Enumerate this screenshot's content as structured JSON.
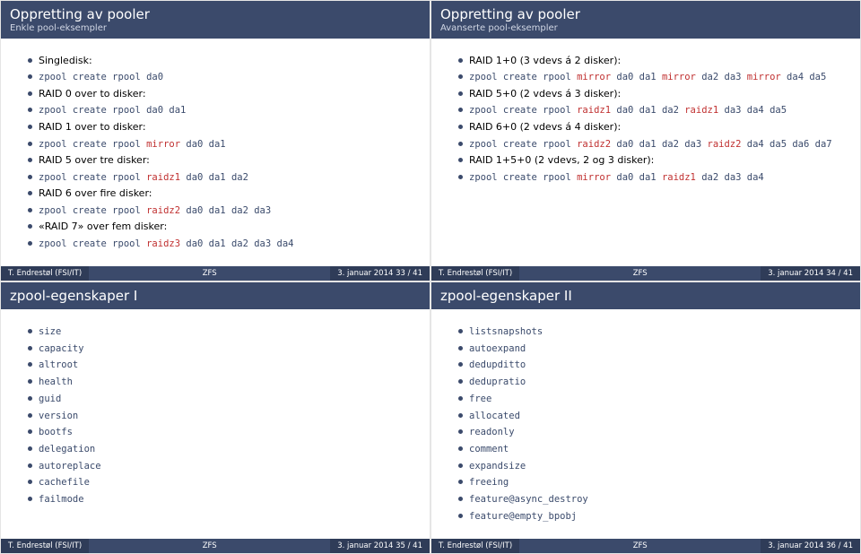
{
  "slides": [
    {
      "title": "Oppretting av pooler",
      "subtitle": "Enkle pool-eksempler",
      "items": [
        [
          {
            "t": "Singledisk:"
          }
        ],
        [
          {
            "t": "zpool create rpool da0",
            "mono": true
          }
        ],
        [
          {
            "t": "RAID 0 over to disker:"
          }
        ],
        [
          {
            "t": "zpool create rpool da0 da1",
            "mono": true
          }
        ],
        [
          {
            "t": "RAID 1 over to disker:"
          }
        ],
        [
          {
            "t": "zpool create rpool ",
            "mono": true
          },
          {
            "t": "mirror",
            "mono": true,
            "kw": true
          },
          {
            "t": " da0 da1",
            "mono": true
          }
        ],
        [
          {
            "t": "RAID 5 over tre disker:"
          }
        ],
        [
          {
            "t": "zpool create rpool ",
            "mono": true
          },
          {
            "t": "raidz1",
            "mono": true,
            "kw": true
          },
          {
            "t": " da0 da1 da2",
            "mono": true
          }
        ],
        [
          {
            "t": "RAID 6 over fire disker:"
          }
        ],
        [
          {
            "t": "zpool create rpool ",
            "mono": true
          },
          {
            "t": "raidz2",
            "mono": true,
            "kw": true
          },
          {
            "t": " da0 da1 da2 da3",
            "mono": true
          }
        ],
        [
          {
            "t": "«RAID 7» over fem disker:"
          }
        ],
        [
          {
            "t": "zpool create rpool ",
            "mono": true
          },
          {
            "t": "raidz3",
            "mono": true,
            "kw": true
          },
          {
            "t": " da0 da1 da2 da3 da4",
            "mono": true
          }
        ]
      ],
      "footer": {
        "left": "T. Endrestøl (FSI/IT)",
        "center": "ZFS",
        "right": "3. januar 2014    33 / 41"
      }
    },
    {
      "title": "Oppretting av pooler",
      "subtitle": "Avanserte pool-eksempler",
      "items": [
        [
          {
            "t": "RAID 1+0 (3 vdevs á 2 disker):"
          }
        ],
        [
          {
            "t": "zpool create rpool ",
            "mono": true
          },
          {
            "t": "mirror",
            "mono": true,
            "kw": true
          },
          {
            "t": " da0 da1 ",
            "mono": true
          },
          {
            "t": "mirror",
            "mono": true,
            "kw": true
          },
          {
            "t": " da2 da3 ",
            "mono": true
          },
          {
            "t": "mirror",
            "mono": true,
            "kw": true
          },
          {
            "t": " da4 da5",
            "mono": true
          }
        ],
        [
          {
            "t": "RAID 5+0 (2 vdevs á 3 disker):"
          }
        ],
        [
          {
            "t": "zpool create rpool ",
            "mono": true
          },
          {
            "t": "raidz1",
            "mono": true,
            "kw": true
          },
          {
            "t": " da0 da1 da2 ",
            "mono": true
          },
          {
            "t": "raidz1",
            "mono": true,
            "kw": true
          },
          {
            "t": " da3 da4 da5",
            "mono": true
          }
        ],
        [
          {
            "t": "RAID 6+0 (2 vdevs á 4 disker):"
          }
        ],
        [
          {
            "t": "zpool create rpool ",
            "mono": true
          },
          {
            "t": "raidz2",
            "mono": true,
            "kw": true
          },
          {
            "t": " da0 da1 da2 da3 ",
            "mono": true
          },
          {
            "t": "raidz2",
            "mono": true,
            "kw": true
          },
          {
            "t": " da4 da5 da6 da7",
            "mono": true
          }
        ],
        [
          {
            "t": "RAID 1+5+0 (2 vdevs, 2 og 3 disker):"
          }
        ],
        [
          {
            "t": "zpool create rpool ",
            "mono": true
          },
          {
            "t": "mirror",
            "mono": true,
            "kw": true
          },
          {
            "t": " da0 da1 ",
            "mono": true
          },
          {
            "t": "raidz1",
            "mono": true,
            "kw": true
          },
          {
            "t": " da2 da3 da4",
            "mono": true
          }
        ]
      ],
      "footer": {
        "left": "T. Endrestøl (FSI/IT)",
        "center": "ZFS",
        "right": "3. januar 2014    34 / 41"
      }
    },
    {
      "title": "zpool-egenskaper I",
      "subtitle": "",
      "items": [
        [
          {
            "t": "size",
            "mono": true
          }
        ],
        [
          {
            "t": "capacity",
            "mono": true
          }
        ],
        [
          {
            "t": "altroot",
            "mono": true
          }
        ],
        [
          {
            "t": "health",
            "mono": true
          }
        ],
        [
          {
            "t": "guid",
            "mono": true
          }
        ],
        [
          {
            "t": "version",
            "mono": true
          }
        ],
        [
          {
            "t": "bootfs",
            "mono": true
          }
        ],
        [
          {
            "t": "delegation",
            "mono": true
          }
        ],
        [
          {
            "t": "autoreplace",
            "mono": true
          }
        ],
        [
          {
            "t": "cachefile",
            "mono": true
          }
        ],
        [
          {
            "t": "failmode",
            "mono": true
          }
        ]
      ],
      "footer": {
        "left": "T. Endrestøl (FSI/IT)",
        "center": "ZFS",
        "right": "3. januar 2014    35 / 41"
      }
    },
    {
      "title": "zpool-egenskaper II",
      "subtitle": "",
      "items": [
        [
          {
            "t": "listsnapshots",
            "mono": true
          }
        ],
        [
          {
            "t": "autoexpand",
            "mono": true
          }
        ],
        [
          {
            "t": "dedupditto",
            "mono": true
          }
        ],
        [
          {
            "t": "dedupratio",
            "mono": true
          }
        ],
        [
          {
            "t": "free",
            "mono": true
          }
        ],
        [
          {
            "t": "allocated",
            "mono": true
          }
        ],
        [
          {
            "t": "readonly",
            "mono": true
          }
        ],
        [
          {
            "t": "comment",
            "mono": true
          }
        ],
        [
          {
            "t": "expandsize",
            "mono": true
          }
        ],
        [
          {
            "t": "freeing",
            "mono": true
          }
        ],
        [
          {
            "t": "feature@async_destroy",
            "mono": true
          }
        ],
        [
          {
            "t": "feature@empty_bpobj",
            "mono": true
          }
        ]
      ],
      "footer": {
        "left": "T. Endrestøl (FSI/IT)",
        "center": "ZFS",
        "right": "3. januar 2014    36 / 41"
      }
    }
  ]
}
